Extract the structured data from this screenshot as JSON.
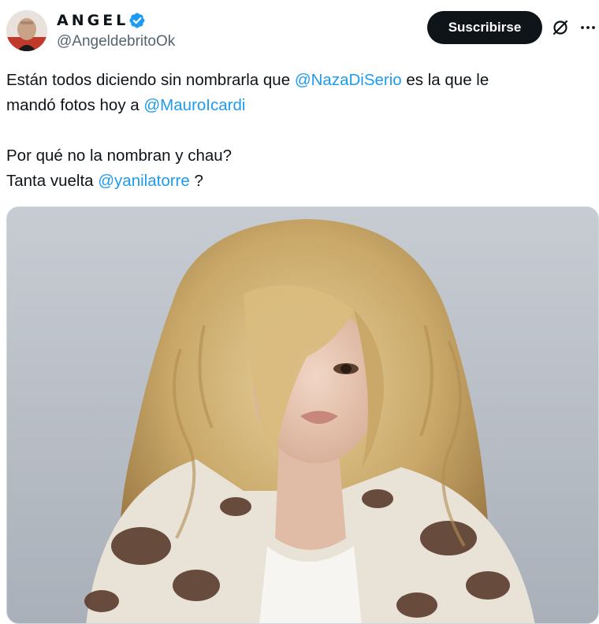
{
  "author": {
    "display_name": "ANGEL",
    "handle": "@AngeldebritoOk",
    "verified": true,
    "verified_color": "#1d9bf0"
  },
  "actions": {
    "subscribe_label": "Suscribirse",
    "grok_icon": "grok-icon",
    "more_icon": "more-options-icon"
  },
  "tweet": {
    "line1_before": "Están todos diciendo sin nombrarla que ",
    "mention1": "@NazaDiSerio",
    "line1_after": " es la que le",
    "line2_before": "mandó fotos hoy a ",
    "mention2": "@MauroIcardi",
    "line3": "Por qué no la nombran y chau?",
    "line4_before": "Tanta vuelta ",
    "mention3": "@yanilatorre",
    "line4_after": " ?"
  },
  "colors": {
    "text": "#0f1419",
    "secondary": "#536471",
    "link": "#1d9bf0",
    "button_bg": "#0f1419",
    "button_text": "#ffffff"
  },
  "media": {
    "type": "photo"
  }
}
